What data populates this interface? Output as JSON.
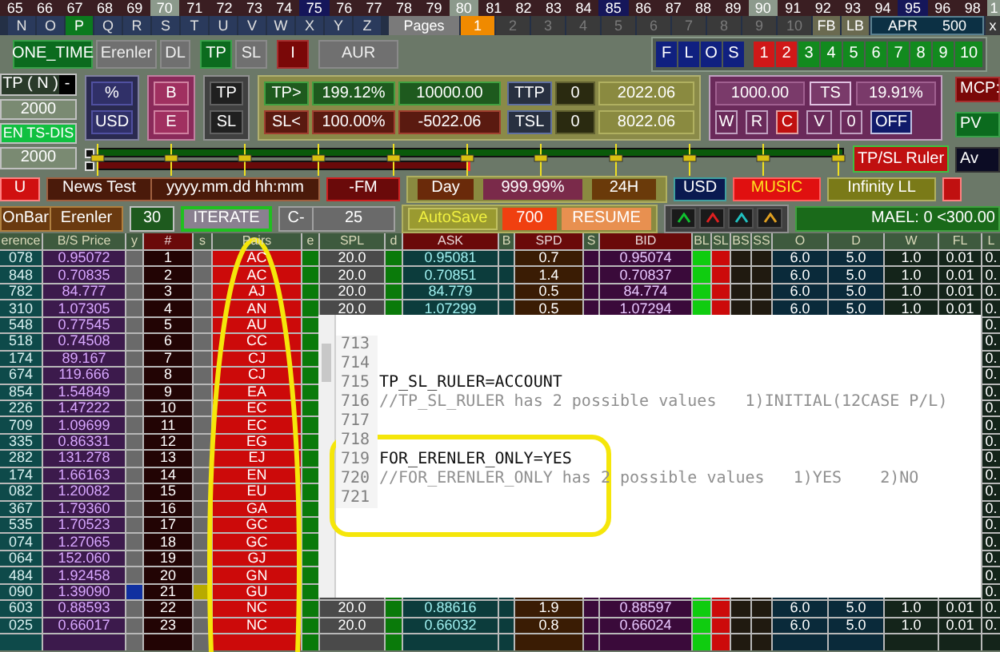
{
  "number_strip": [
    {
      "label": "65",
      "kind": "plain"
    },
    {
      "label": "66",
      "kind": "plain"
    },
    {
      "label": "67",
      "kind": "plain"
    },
    {
      "label": "68",
      "kind": "plain"
    },
    {
      "label": "69",
      "kind": "plain"
    },
    {
      "label": "70",
      "kind": "ten"
    },
    {
      "label": "71",
      "kind": "plain"
    },
    {
      "label": "72",
      "kind": "plain"
    },
    {
      "label": "73",
      "kind": "plain"
    },
    {
      "label": "74",
      "kind": "plain"
    },
    {
      "label": "75",
      "kind": "five"
    },
    {
      "label": "76",
      "kind": "plain"
    },
    {
      "label": "77",
      "kind": "plain"
    },
    {
      "label": "78",
      "kind": "plain"
    },
    {
      "label": "79",
      "kind": "plain"
    },
    {
      "label": "80",
      "kind": "ten"
    },
    {
      "label": "81",
      "kind": "plain"
    },
    {
      "label": "82",
      "kind": "plain"
    },
    {
      "label": "83",
      "kind": "plain"
    },
    {
      "label": "84",
      "kind": "plain"
    },
    {
      "label": "85",
      "kind": "five"
    },
    {
      "label": "86",
      "kind": "plain"
    },
    {
      "label": "87",
      "kind": "plain"
    },
    {
      "label": "88",
      "kind": "plain"
    },
    {
      "label": "89",
      "kind": "plain"
    },
    {
      "label": "90",
      "kind": "ten"
    },
    {
      "label": "91",
      "kind": "plain"
    },
    {
      "label": "92",
      "kind": "plain"
    },
    {
      "label": "93",
      "kind": "plain"
    },
    {
      "label": "94",
      "kind": "plain"
    },
    {
      "label": "95",
      "kind": "five"
    },
    {
      "label": "96",
      "kind": "plain"
    },
    {
      "label": "98",
      "kind": "plain"
    },
    {
      "label": "1",
      "kind": "ten"
    }
  ],
  "letter_strip": [
    {
      "label": "N",
      "selected": false
    },
    {
      "label": "O",
      "selected": false
    },
    {
      "label": "P",
      "selected": true
    },
    {
      "label": "Q",
      "selected": false
    },
    {
      "label": "R",
      "selected": false
    },
    {
      "label": "S",
      "selected": false
    },
    {
      "label": "T",
      "selected": false
    },
    {
      "label": "U",
      "selected": false
    },
    {
      "label": "V",
      "selected": false
    },
    {
      "label": "W",
      "selected": false
    },
    {
      "label": "X",
      "selected": false
    },
    {
      "label": "Y",
      "selected": false
    },
    {
      "label": "Z",
      "selected": false
    }
  ],
  "pages": {
    "label": "Pages",
    "items": [
      {
        "label": "1",
        "selected": true
      },
      {
        "label": "2",
        "selected": false
      },
      {
        "label": "3",
        "selected": false
      },
      {
        "label": "4",
        "selected": false
      },
      {
        "label": "5",
        "selected": false
      },
      {
        "label": "6",
        "selected": false
      },
      {
        "label": "7",
        "selected": false
      },
      {
        "label": "8",
        "selected": false
      },
      {
        "label": "9",
        "selected": false
      },
      {
        "label": "10",
        "selected": false
      }
    ]
  },
  "page_nav": [
    "FB",
    "LB"
  ],
  "apr": {
    "label": "APR",
    "value": "500"
  },
  "close": "x",
  "mode_buttons": [
    {
      "label": "ONE_TIME",
      "kind": "on"
    },
    {
      "label": "Erenler",
      "kind": "off"
    },
    {
      "label": "DL",
      "kind": "off"
    },
    {
      "label": "TP",
      "kind": "on"
    },
    {
      "label": "SL",
      "kind": "off"
    },
    {
      "label": "I",
      "kind": "alert"
    },
    {
      "label": "AUR",
      "kind": "off"
    }
  ],
  "flos": [
    "F",
    "L",
    "O",
    "S"
  ],
  "slots": [
    {
      "label": "1",
      "color": "#d01818"
    },
    {
      "label": "2",
      "color": "#d01818"
    },
    {
      "label": "3",
      "color": "#128a1e"
    },
    {
      "label": "4",
      "color": "#128a1e"
    },
    {
      "label": "5",
      "color": "#128a1e"
    },
    {
      "label": "6",
      "color": "#128a1e"
    },
    {
      "label": "7",
      "color": "#128a1e"
    },
    {
      "label": "8",
      "color": "#128a1e"
    },
    {
      "label": "9",
      "color": "#128a1e"
    },
    {
      "label": "10",
      "color": "#128a1e"
    }
  ],
  "left_panel": {
    "tp_label": "TP ( N )",
    "toggle": "-",
    "tp_value": "2000",
    "ts_label": "EN TS-DIS",
    "ts_value": "2000"
  },
  "unit_buttons": [
    "%",
    "USD"
  ],
  "side_buttons": [
    "B",
    "E"
  ],
  "type_buttons": [
    "TP",
    "SL"
  ],
  "targets": [
    {
      "label": "TP>",
      "percent": "199.12%",
      "amount": "10000.00",
      "kind": "tp"
    },
    {
      "label": "SL<",
      "percent": "100.00%",
      "amount": "-5022.06",
      "kind": "sl"
    }
  ],
  "trailing": [
    {
      "label": "TTP",
      "count": "0",
      "amount": "2022.06"
    },
    {
      "label": "TSL",
      "count": "0",
      "amount": "8022.06"
    }
  ],
  "trail": {
    "amount": "1000.00",
    "ts": "TS",
    "percent": "19.91%",
    "buttons": [
      {
        "label": "W",
        "kind": "plain"
      },
      {
        "label": "R",
        "kind": "plain"
      },
      {
        "label": "C",
        "kind": "alert"
      },
      {
        "label": "V",
        "kind": "plain"
      },
      {
        "label": "0",
        "kind": "plain"
      },
      {
        "label": "OFF",
        "kind": "toggle"
      }
    ]
  },
  "side_panel": [
    {
      "label": "MCP:",
      "kind": "alert"
    },
    {
      "label": "PV",
      "kind": "on"
    },
    {
      "label": "Av",
      "kind": "dark"
    }
  ],
  "ruler_button": "TP/SL Ruler",
  "news_bar": {
    "u": "U",
    "label": "News Test",
    "format": "yyyy.mm.dd hh:mm",
    "fm": "-FM"
  },
  "day_bar": {
    "day": "Day",
    "percent": "999.99%",
    "hours": "24H"
  },
  "right_bar": [
    {
      "label": "USD",
      "kind": "currency"
    },
    {
      "label": "MUSIC",
      "kind": "alert"
    },
    {
      "label": "Infinity LL",
      "kind": "toggle"
    }
  ],
  "bar2": {
    "onbar": "OnBar",
    "erenler": "Erenler",
    "period": "30",
    "iterate": "ITERATE",
    "c_label": "C-",
    "c_value": "25",
    "autosave": "AutoSave",
    "autosave_value": "700",
    "resume": "RESUME",
    "mael": "MAEL: 0 <300.00"
  },
  "signal_icons": [
    {
      "color": "#10c030"
    },
    {
      "color": "#e02020"
    },
    {
      "color": "#20c0c0"
    },
    {
      "color": "#e0a020"
    }
  ],
  "table": {
    "columns": [
      "erence",
      "B/S Price",
      "y",
      "#",
      "s",
      "Pairs",
      "e",
      "SPL",
      "d",
      "ASK",
      "B",
      "SPD",
      "S",
      "BID",
      "BL",
      "SL",
      "BS",
      "SS",
      "O",
      "D",
      "W",
      "FL",
      "L"
    ],
    "rows": [
      {
        "difference": "078",
        "bs_price": "0.95072",
        "y_marked": false,
        "number": "1",
        "s_marked": false,
        "pair": "AC",
        "spl": "20.0",
        "ask": "0.95081",
        "spd": "0.7",
        "bid": "0.95074",
        "o": "6.0",
        "d": "5.0",
        "w": "1.0",
        "fl": "0.01",
        "l": "0."
      },
      {
        "difference": "848",
        "bs_price": "0.70835",
        "y_marked": false,
        "number": "2",
        "s_marked": false,
        "pair": "AC",
        "spl": "20.0",
        "ask": "0.70851",
        "spd": "1.4",
        "bid": "0.70837",
        "o": "6.0",
        "d": "5.0",
        "w": "1.0",
        "fl": "0.01",
        "l": "0."
      },
      {
        "difference": "782",
        "bs_price": "84.777",
        "y_marked": false,
        "number": "3",
        "s_marked": false,
        "pair": "AJ",
        "spl": "20.0",
        "ask": "84.779",
        "spd": "0.5",
        "bid": "84.774",
        "o": "6.0",
        "d": "5.0",
        "w": "1.0",
        "fl": "0.01",
        "l": "0."
      },
      {
        "difference": "310",
        "bs_price": "1.07305",
        "y_marked": false,
        "number": "4",
        "s_marked": false,
        "pair": "AN",
        "spl": "20.0",
        "ask": "1.07299",
        "spd": "0.5",
        "bid": "1.07294",
        "o": "6.0",
        "d": "5.0",
        "w": "1.0",
        "fl": "0.01",
        "l": "0."
      },
      {
        "difference": "548",
        "bs_price": "0.77545",
        "y_marked": false,
        "number": "5",
        "s_marked": false,
        "pair": "AU",
        "l": "0."
      },
      {
        "difference": "518",
        "bs_price": "0.74508",
        "y_marked": false,
        "number": "6",
        "s_marked": false,
        "pair": "CC",
        "l": "0."
      },
      {
        "difference": "174",
        "bs_price": "89.167",
        "y_marked": false,
        "number": "7",
        "s_marked": false,
        "pair": "CJ",
        "l": "0."
      },
      {
        "difference": "674",
        "bs_price": "119.666",
        "y_marked": false,
        "number": "8",
        "s_marked": false,
        "pair": "CJ",
        "l": "0."
      },
      {
        "difference": "854",
        "bs_price": "1.54849",
        "y_marked": false,
        "number": "9",
        "s_marked": false,
        "pair": "EA",
        "l": "0."
      },
      {
        "difference": "226",
        "bs_price": "1.47222",
        "y_marked": false,
        "number": "10",
        "s_marked": false,
        "pair": "EC",
        "l": "0."
      },
      {
        "difference": "709",
        "bs_price": "1.09699",
        "y_marked": false,
        "number": "11",
        "s_marked": false,
        "pair": "EC",
        "l": "0."
      },
      {
        "difference": "335",
        "bs_price": "0.86331",
        "y_marked": false,
        "number": "12",
        "s_marked": false,
        "pair": "EG",
        "l": "0."
      },
      {
        "difference": "282",
        "bs_price": "131.278",
        "y_marked": false,
        "number": "13",
        "s_marked": false,
        "pair": "EJ",
        "l": "0."
      },
      {
        "difference": "174",
        "bs_price": "1.66163",
        "y_marked": false,
        "number": "14",
        "s_marked": false,
        "pair": "EN",
        "l": "0."
      },
      {
        "difference": "082",
        "bs_price": "1.20082",
        "y_marked": false,
        "number": "15",
        "s_marked": false,
        "pair": "EU",
        "l": "0."
      },
      {
        "difference": "367",
        "bs_price": "1.79360",
        "y_marked": false,
        "number": "16",
        "s_marked": false,
        "pair": "GA",
        "l": "0."
      },
      {
        "difference": "535",
        "bs_price": "1.70523",
        "y_marked": false,
        "number": "17",
        "s_marked": false,
        "pair": "GC",
        "l": "0."
      },
      {
        "difference": "074",
        "bs_price": "1.27065",
        "y_marked": false,
        "number": "18",
        "s_marked": false,
        "pair": "GC",
        "l": "0."
      },
      {
        "difference": "064",
        "bs_price": "152.060",
        "y_marked": false,
        "number": "19",
        "s_marked": false,
        "pair": "GJ",
        "l": "0."
      },
      {
        "difference": "484",
        "bs_price": "1.92458",
        "y_marked": false,
        "number": "20",
        "s_marked": false,
        "pair": "GN",
        "l": "0."
      },
      {
        "difference": "090",
        "bs_price": "1.39090",
        "y_marked": true,
        "number": "21",
        "s_marked": true,
        "pair": "GU",
        "l": "0."
      },
      {
        "difference": "603",
        "bs_price": "0.88593",
        "y_marked": false,
        "number": "22",
        "s_marked": false,
        "pair": "NC",
        "spl": "20.0",
        "ask": "0.88616",
        "spd": "1.9",
        "bid": "0.88597",
        "o": "6.0",
        "d": "5.0",
        "w": "1.0",
        "fl": "0.01",
        "l": "0."
      },
      {
        "difference": "025",
        "bs_price": "0.66017",
        "y_marked": false,
        "number": "23",
        "s_marked": false,
        "pair": "NC",
        "spl": "20.0",
        "ask": "0.66032",
        "spd": "0.8",
        "bid": "0.66024",
        "o": "6.0",
        "d": "5.0",
        "w": "1.0",
        "fl": "0.01",
        "l": "0."
      }
    ]
  },
  "editor": {
    "lines": [
      {
        "number": "713",
        "kind": "blank"
      },
      {
        "number": "714",
        "kind": "blank"
      },
      {
        "number": "715",
        "text": "TP_SL_RULER=ACCOUNT",
        "kind": "code"
      },
      {
        "number": "716",
        "text": "//TP_SL_RULER has 2 possible values   1)INITIAL(12CASE P/L)",
        "kind": "comment"
      },
      {
        "number": "717",
        "kind": "blank"
      },
      {
        "number": "718",
        "kind": "blank"
      },
      {
        "number": "719",
        "text": "FOR_ERENLER_ONLY=YES",
        "kind": "code"
      },
      {
        "number": "720",
        "text": "//FOR_ERENLER_ONLY has 2 possible values   1)YES    2)NO",
        "kind": "comment"
      },
      {
        "number": "721",
        "kind": "blank"
      }
    ]
  }
}
